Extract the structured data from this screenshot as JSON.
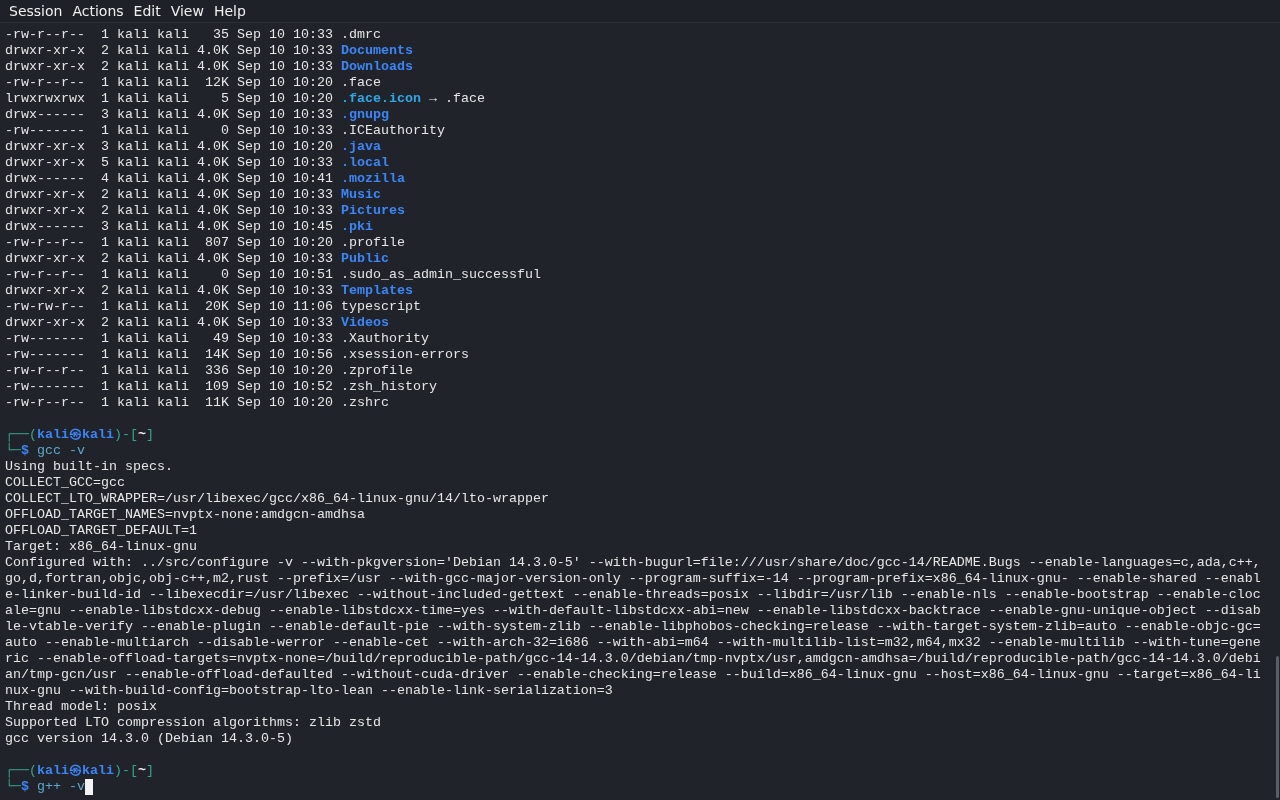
{
  "menu": [
    "Session",
    "Actions",
    "Edit",
    "View",
    "Help"
  ],
  "listing": [
    {
      "mode": "-rw-r--r--",
      "links": "1",
      "user": "kali",
      "group": "kali",
      "size": "35",
      "month": "Sep",
      "day": "10",
      "time": "10:33",
      "name": ".dmrc",
      "kind": "file"
    },
    {
      "mode": "drwxr-xr-x",
      "links": "2",
      "user": "kali",
      "group": "kali",
      "size": "4.0K",
      "month": "Sep",
      "day": "10",
      "time": "10:33",
      "name": "Documents",
      "kind": "dir"
    },
    {
      "mode": "drwxr-xr-x",
      "links": "2",
      "user": "kali",
      "group": "kali",
      "size": "4.0K",
      "month": "Sep",
      "day": "10",
      "time": "10:33",
      "name": "Downloads",
      "kind": "dir"
    },
    {
      "mode": "-rw-r--r--",
      "links": "1",
      "user": "kali",
      "group": "kali",
      "size": "12K",
      "month": "Sep",
      "day": "10",
      "time": "10:20",
      "name": ".face",
      "kind": "file"
    },
    {
      "mode": "lrwxrwxrwx",
      "links": "1",
      "user": "kali",
      "group": "kali",
      "size": "5",
      "month": "Sep",
      "day": "10",
      "time": "10:20",
      "name": ".face.icon",
      "kind": "link",
      "arrow": "→",
      "target": ".face"
    },
    {
      "mode": "drwx------",
      "links": "3",
      "user": "kali",
      "group": "kali",
      "size": "4.0K",
      "month": "Sep",
      "day": "10",
      "time": "10:33",
      "name": ".gnupg",
      "kind": "dir"
    },
    {
      "mode": "-rw-------",
      "links": "1",
      "user": "kali",
      "group": "kali",
      "size": "0",
      "month": "Sep",
      "day": "10",
      "time": "10:33",
      "name": ".ICEauthority",
      "kind": "file"
    },
    {
      "mode": "drwxr-xr-x",
      "links": "3",
      "user": "kali",
      "group": "kali",
      "size": "4.0K",
      "month": "Sep",
      "day": "10",
      "time": "10:20",
      "name": ".java",
      "kind": "dir"
    },
    {
      "mode": "drwxr-xr-x",
      "links": "5",
      "user": "kali",
      "group": "kali",
      "size": "4.0K",
      "month": "Sep",
      "day": "10",
      "time": "10:33",
      "name": ".local",
      "kind": "dir"
    },
    {
      "mode": "drwx------",
      "links": "4",
      "user": "kali",
      "group": "kali",
      "size": "4.0K",
      "month": "Sep",
      "day": "10",
      "time": "10:41",
      "name": ".mozilla",
      "kind": "dir"
    },
    {
      "mode": "drwxr-xr-x",
      "links": "2",
      "user": "kali",
      "group": "kali",
      "size": "4.0K",
      "month": "Sep",
      "day": "10",
      "time": "10:33",
      "name": "Music",
      "kind": "dir"
    },
    {
      "mode": "drwxr-xr-x",
      "links": "2",
      "user": "kali",
      "group": "kali",
      "size": "4.0K",
      "month": "Sep",
      "day": "10",
      "time": "10:33",
      "name": "Pictures",
      "kind": "dir"
    },
    {
      "mode": "drwx------",
      "links": "3",
      "user": "kali",
      "group": "kali",
      "size": "4.0K",
      "month": "Sep",
      "day": "10",
      "time": "10:45",
      "name": ".pki",
      "kind": "dir"
    },
    {
      "mode": "-rw-r--r--",
      "links": "1",
      "user": "kali",
      "group": "kali",
      "size": "807",
      "month": "Sep",
      "day": "10",
      "time": "10:20",
      "name": ".profile",
      "kind": "file"
    },
    {
      "mode": "drwxr-xr-x",
      "links": "2",
      "user": "kali",
      "group": "kali",
      "size": "4.0K",
      "month": "Sep",
      "day": "10",
      "time": "10:33",
      "name": "Public",
      "kind": "dir"
    },
    {
      "mode": "-rw-r--r--",
      "links": "1",
      "user": "kali",
      "group": "kali",
      "size": "0",
      "month": "Sep",
      "day": "10",
      "time": "10:51",
      "name": ".sudo_as_admin_successful",
      "kind": "file"
    },
    {
      "mode": "drwxr-xr-x",
      "links": "2",
      "user": "kali",
      "group": "kali",
      "size": "4.0K",
      "month": "Sep",
      "day": "10",
      "time": "10:33",
      "name": "Templates",
      "kind": "dir"
    },
    {
      "mode": "-rw-rw-r--",
      "links": "1",
      "user": "kali",
      "group": "kali",
      "size": "20K",
      "month": "Sep",
      "day": "10",
      "time": "11:06",
      "name": "typescript",
      "kind": "file"
    },
    {
      "mode": "drwxr-xr-x",
      "links": "2",
      "user": "kali",
      "group": "kali",
      "size": "4.0K",
      "month": "Sep",
      "day": "10",
      "time": "10:33",
      "name": "Videos",
      "kind": "dir"
    },
    {
      "mode": "-rw-------",
      "links": "1",
      "user": "kali",
      "group": "kali",
      "size": "49",
      "month": "Sep",
      "day": "10",
      "time": "10:33",
      "name": ".Xauthority",
      "kind": "file"
    },
    {
      "mode": "-rw-------",
      "links": "1",
      "user": "kali",
      "group": "kali",
      "size": "14K",
      "month": "Sep",
      "day": "10",
      "time": "10:56",
      "name": ".xsession-errors",
      "kind": "file"
    },
    {
      "mode": "-rw-r--r--",
      "links": "1",
      "user": "kali",
      "group": "kali",
      "size": "336",
      "month": "Sep",
      "day": "10",
      "time": "10:20",
      "name": ".zprofile",
      "kind": "file"
    },
    {
      "mode": "-rw-------",
      "links": "1",
      "user": "kali",
      "group": "kali",
      "size": "109",
      "month": "Sep",
      "day": "10",
      "time": "10:52",
      "name": ".zsh_history",
      "kind": "file"
    },
    {
      "mode": "-rw-r--r--",
      "links": "1",
      "user": "kali",
      "group": "kali",
      "size": "11K",
      "month": "Sep",
      "day": "10",
      "time": "10:20",
      "name": ".zshrc",
      "kind": "file"
    }
  ],
  "commands": [
    {
      "prompt": {
        "open": "┌──(",
        "user": "kali",
        "at": "㉿",
        "host": "kali",
        "mid": ")-[",
        "cwd": "~",
        "close": "]",
        "second": "└─",
        "sign": "$"
      },
      "command": "gcc -v",
      "cursor": false,
      "output": [
        "Using built-in specs.",
        "COLLECT_GCC=gcc",
        "COLLECT_LTO_WRAPPER=/usr/libexec/gcc/x86_64-linux-gnu/14/lto-wrapper",
        "OFFLOAD_TARGET_NAMES=nvptx-none:amdgcn-amdhsa",
        "OFFLOAD_TARGET_DEFAULT=1",
        "Target: x86_64-linux-gnu",
        "Configured with: ../src/configure -v --with-pkgversion='Debian 14.3.0-5' --with-bugurl=file:///usr/share/doc/gcc-14/README.Bugs --enable-languages=c,ada,c++,",
        "go,d,fortran,objc,obj-c++,m2,rust --prefix=/usr --with-gcc-major-version-only --program-suffix=-14 --program-prefix=x86_64-linux-gnu- --enable-shared --enabl",
        "e-linker-build-id --libexecdir=/usr/libexec --without-included-gettext --enable-threads=posix --libdir=/usr/lib --enable-nls --enable-bootstrap --enable-cloc",
        "ale=gnu --enable-libstdcxx-debug --enable-libstdcxx-time=yes --with-default-libstdcxx-abi=new --enable-libstdcxx-backtrace --enable-gnu-unique-object --disab",
        "le-vtable-verify --enable-plugin --enable-default-pie --with-system-zlib --enable-libphobos-checking=release --with-target-system-zlib=auto --enable-objc-gc=",
        "auto --enable-multiarch --disable-werror --enable-cet --with-arch-32=i686 --with-abi=m64 --with-multilib-list=m32,m64,mx32 --enable-multilib --with-tune=gene",
        "ric --enable-offload-targets=nvptx-none=/build/reproducible-path/gcc-14-14.3.0/debian/tmp-nvptx/usr,amdgcn-amdhsa=/build/reproducible-path/gcc-14-14.3.0/debi",
        "an/tmp-gcn/usr --enable-offload-defaulted --without-cuda-driver --enable-checking=release --build=x86_64-linux-gnu --host=x86_64-linux-gnu --target=x86_64-li",
        "nux-gnu --with-build-config=bootstrap-lto-lean --enable-link-serialization=3",
        "Thread model: posix",
        "Supported LTO compression algorithms: zlib zstd",
        "gcc version 14.3.0 (Debian 14.3.0-5)"
      ]
    },
    {
      "prompt": {
        "open": "┌──(",
        "user": "kali",
        "at": "㉿",
        "host": "kali",
        "mid": ")-[",
        "cwd": "~",
        "close": "]",
        "second": "└─",
        "sign": "$"
      },
      "command": "g++ -v",
      "cursor": true
    }
  ]
}
